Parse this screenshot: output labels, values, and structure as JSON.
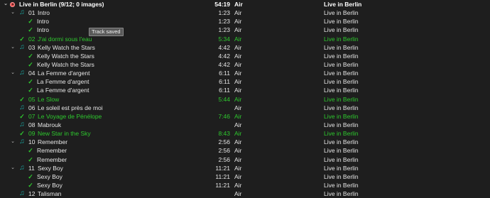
{
  "playlist": {
    "title": "Live in Berlin (9/12; 0 images)",
    "duration": "54:19",
    "artist": "Air",
    "album": "Live in Berlin"
  },
  "rows": [
    {
      "kind": "track",
      "num": "01",
      "name": "Intro",
      "time": "1:23",
      "artist": "Air",
      "album": "Live in Berlin",
      "expanded": true,
      "green": false
    },
    {
      "kind": "file",
      "name": "Intro",
      "time": "1:23",
      "artist": "Air",
      "album": "Live in Berlin",
      "green": false
    },
    {
      "kind": "file",
      "name": "Intro",
      "time": "1:23",
      "artist": "Air",
      "album": "Live in Berlin",
      "green": false
    },
    {
      "kind": "saved",
      "num": "02",
      "name": "J'ai dormi sous l'eau",
      "time": "5:34",
      "artist": "Air",
      "album": "Live in Berlin",
      "green": true
    },
    {
      "kind": "track",
      "num": "03",
      "name": "Kelly Watch the Stars",
      "time": "4:42",
      "artist": "Air",
      "album": "Live in Berlin",
      "expanded": true,
      "green": false
    },
    {
      "kind": "file",
      "name": "Kelly Watch the Stars",
      "time": "4:42",
      "artist": "Air",
      "album": "Live in Berlin",
      "green": false
    },
    {
      "kind": "file",
      "name": "Kelly Watch the Stars",
      "time": "4:42",
      "artist": "Air",
      "album": "Live in Berlin",
      "green": false
    },
    {
      "kind": "track",
      "num": "04",
      "name": "La Femme d'argent",
      "time": "6:11",
      "artist": "Air",
      "album": "Live in Berlin",
      "expanded": true,
      "green": false
    },
    {
      "kind": "file",
      "name": "La Femme d'argent",
      "time": "6:11",
      "artist": "Air",
      "album": "Live in Berlin",
      "green": false
    },
    {
      "kind": "file",
      "name": "La Femme d'argent",
      "time": "6:11",
      "artist": "Air",
      "album": "Live in Berlin",
      "green": false
    },
    {
      "kind": "saved",
      "num": "05",
      "name": "Le Slow",
      "time": "5:44",
      "artist": "Air",
      "album": "Live in Berlin",
      "green": true
    },
    {
      "kind": "plain",
      "num": "06",
      "name": "Le soleil est près de moi",
      "time": "",
      "artist": "Air",
      "album": "Live in Berlin",
      "green": false
    },
    {
      "kind": "saved",
      "num": "07",
      "name": "Le Voyage de Pénélope",
      "time": "7:46",
      "artist": "Air",
      "album": "Live in Berlin",
      "green": true
    },
    {
      "kind": "plain",
      "num": "08",
      "name": "Mabrouk",
      "time": "",
      "artist": "Air",
      "album": "Live in Berlin",
      "green": false
    },
    {
      "kind": "saved",
      "num": "09",
      "name": "New Star in the Sky",
      "time": "8:43",
      "artist": "Air",
      "album": "Live in Berlin",
      "green": true
    },
    {
      "kind": "track",
      "num": "10",
      "name": "Remember",
      "time": "2:56",
      "artist": "Air",
      "album": "Live in Berlin",
      "expanded": true,
      "green": false
    },
    {
      "kind": "file",
      "name": "Remember",
      "time": "2:56",
      "artist": "Air",
      "album": "Live in Berlin",
      "green": false
    },
    {
      "kind": "file",
      "name": "Remember",
      "time": "2:56",
      "artist": "Air",
      "album": "Live in Berlin",
      "green": false
    },
    {
      "kind": "track",
      "num": "11",
      "name": "Sexy Boy",
      "time": "11:21",
      "artist": "Air",
      "album": "Live in Berlin",
      "expanded": true,
      "green": false
    },
    {
      "kind": "file",
      "name": "Sexy Boy",
      "time": "11:21",
      "artist": "Air",
      "album": "Live in Berlin",
      "green": false
    },
    {
      "kind": "file",
      "name": "Sexy Boy",
      "time": "11:21",
      "artist": "Air",
      "album": "Live in Berlin",
      "green": false
    },
    {
      "kind": "plain",
      "num": "12",
      "name": "Talisman",
      "time": "",
      "artist": "Air",
      "album": "Live in Berlin",
      "green": false
    }
  ],
  "tooltip": {
    "text": "Track saved"
  },
  "icons": {
    "collapse": "chevron-down-icon",
    "note": "music-note-icon",
    "check": "checkmark-icon",
    "disc": "album-disc-icon"
  },
  "colors": {
    "saved_green": "#2ec82e",
    "note_teal": "#1aa6a0",
    "disc_red": "#e04545"
  }
}
